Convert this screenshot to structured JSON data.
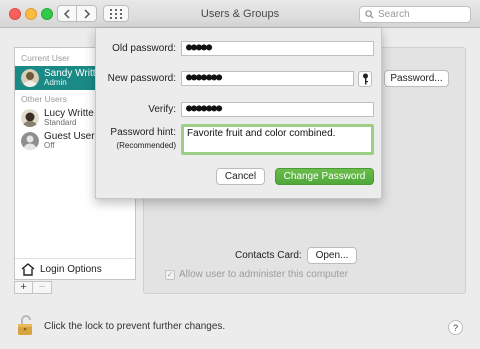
{
  "window": {
    "title": "Users & Groups"
  },
  "search": {
    "placeholder": "Search"
  },
  "sidebar": {
    "current_user_label": "Current User",
    "other_users_label": "Other Users",
    "current_user": {
      "name": "Sandy Writt",
      "role": "Admin"
    },
    "other_users": [
      {
        "name": "Lucy Writte",
        "role": "Standard"
      },
      {
        "name": "Guest User",
        "role": "Off"
      }
    ],
    "login_options": "Login Options",
    "add_label": "+",
    "remove_label": "−"
  },
  "panel": {
    "password_button": "Password...",
    "contacts_label": "Contacts Card:",
    "open_button": "Open...",
    "admin_checkbox_label": "Allow user to administer this computer",
    "admin_checked": true
  },
  "sheet": {
    "old_password_label": "Old password:",
    "old_password_value": "●●●●●",
    "new_password_label": "New password:",
    "new_password_value": "●●●●●●●",
    "verify_label": "Verify:",
    "verify_value": "●●●●●●●",
    "hint_label": "Password hint:",
    "hint_sub": "(Recommended)",
    "hint_value": "Favorite fruit and color combined.",
    "cancel": "Cancel",
    "change": "Change Password"
  },
  "footer": {
    "lock_text": "Click the lock to prevent further changes.",
    "help": "?"
  },
  "colors": {
    "selection": "#1b8a87",
    "primary": "#4fa83a",
    "hint_focus": "#9fce89"
  },
  "icons": [
    "back-icon",
    "forward-icon",
    "grid-icon",
    "search-icon",
    "avatar",
    "house-icon",
    "key-icon",
    "lock-icon",
    "help-icon"
  ]
}
